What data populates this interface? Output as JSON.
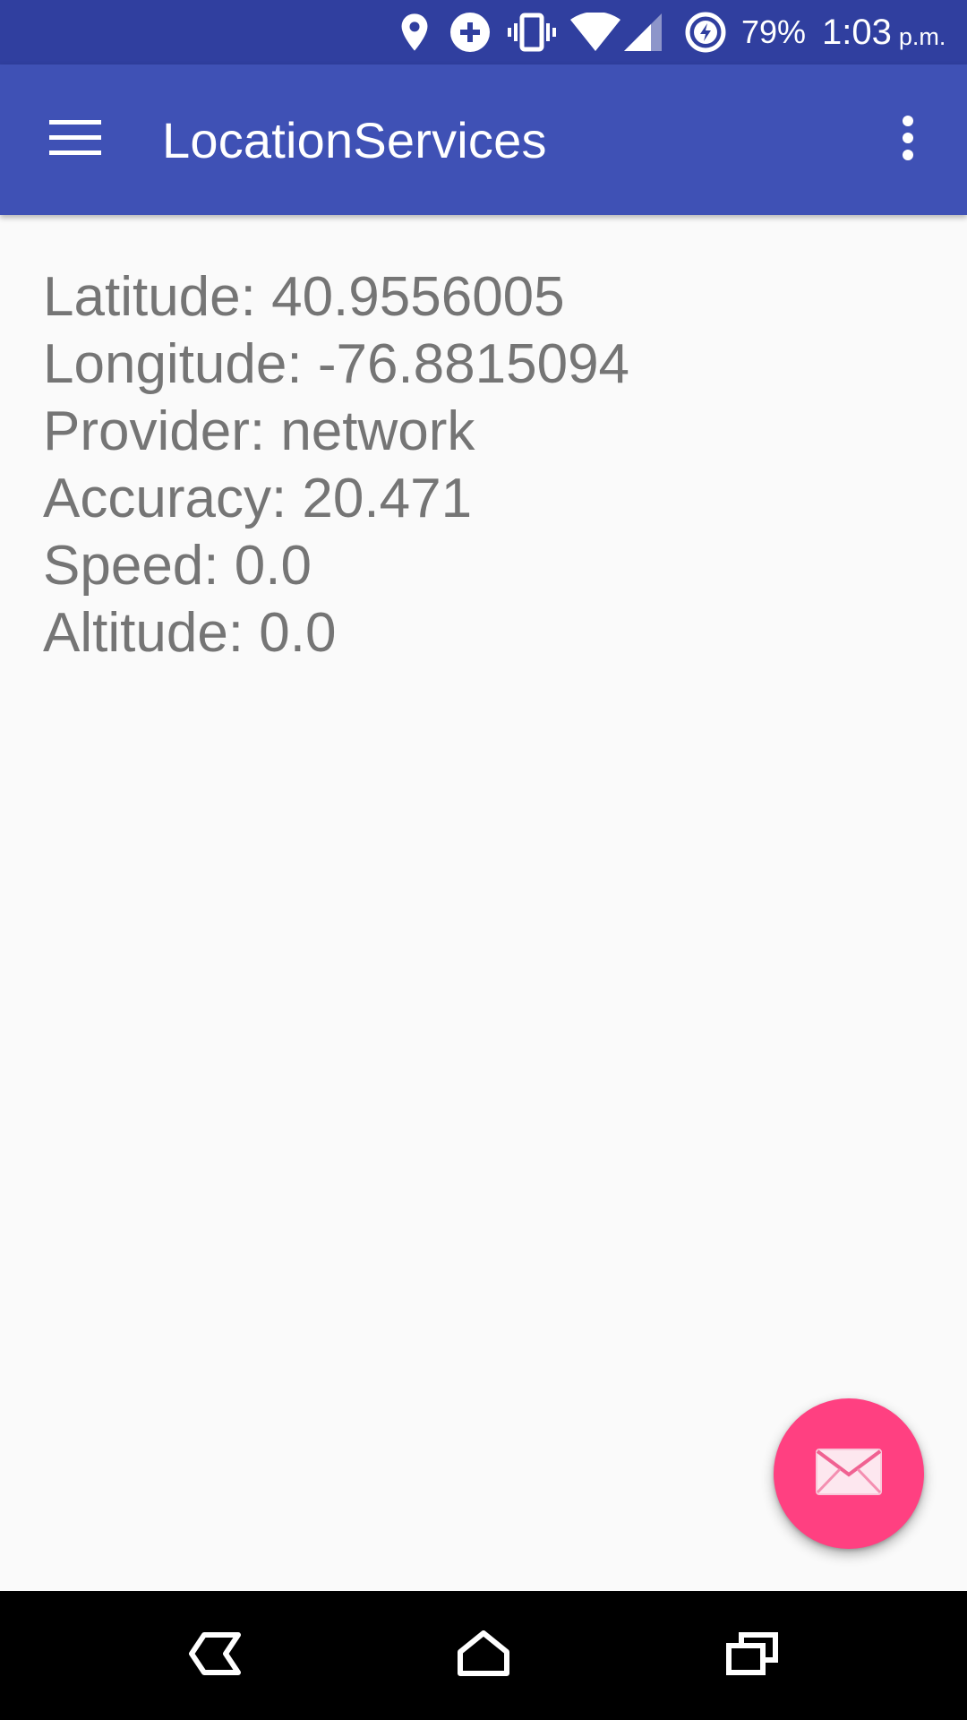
{
  "status_bar": {
    "battery_percent": "79%",
    "time": "1:03",
    "am_pm": "p.m.",
    "icons": [
      "location-pin-icon",
      "data-saver-icon",
      "vibrate-icon",
      "wifi-icon",
      "cell-signal-icon",
      "battery-saver-icon"
    ]
  },
  "app_bar": {
    "title": "LocationServices",
    "menu_icon": "hamburger-menu-icon",
    "overflow_icon": "more-vert-icon"
  },
  "location_info": {
    "latitude": "Latitude: 40.9556005",
    "longitude": "Longitude: -76.8815094",
    "provider": "Provider: network",
    "accuracy": "Accuracy: 20.471",
    "speed": "Speed: 0.0",
    "altitude": "Altitude: 0.0"
  },
  "fab": {
    "icon": "email-icon",
    "color": "#ff4081"
  },
  "nav_bar": {
    "icons": [
      "back-icon",
      "home-icon",
      "recents-icon"
    ]
  },
  "colors": {
    "status_bar": "#303f9f",
    "app_bar": "#3f51b5",
    "text": "#757575",
    "background": "#fafafa"
  }
}
